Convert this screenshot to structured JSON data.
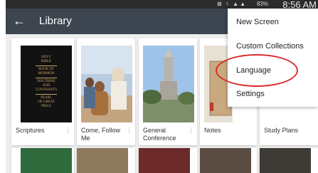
{
  "status_bar": {
    "icons": "⊠ ♮ ▲▲",
    "battery": "83%",
    "time": "8:56 AM"
  },
  "app_bar": {
    "back_icon": "arrow-left",
    "title": "Library"
  },
  "cards": [
    {
      "label": "Scriptures",
      "cover_lines": [
        "HOLY",
        "BIBLE",
        "BOOK OF",
        "MORMON",
        "DOCTRINE",
        "AND",
        "COVENANTS",
        "PEARL",
        "OF GREAT",
        "PRICE"
      ]
    },
    {
      "label": "Come, Follow Me"
    },
    {
      "label": "General Conference"
    },
    {
      "label": "Notes"
    },
    {
      "label": "Study Plans"
    }
  ],
  "menu": {
    "items": [
      "New Screen",
      "Custom Collections",
      "Language",
      "Settings"
    ]
  },
  "colors": {
    "app_bar": "#3d4550",
    "highlight": "#d92a2a",
    "cover_gold": "#c7a564"
  }
}
